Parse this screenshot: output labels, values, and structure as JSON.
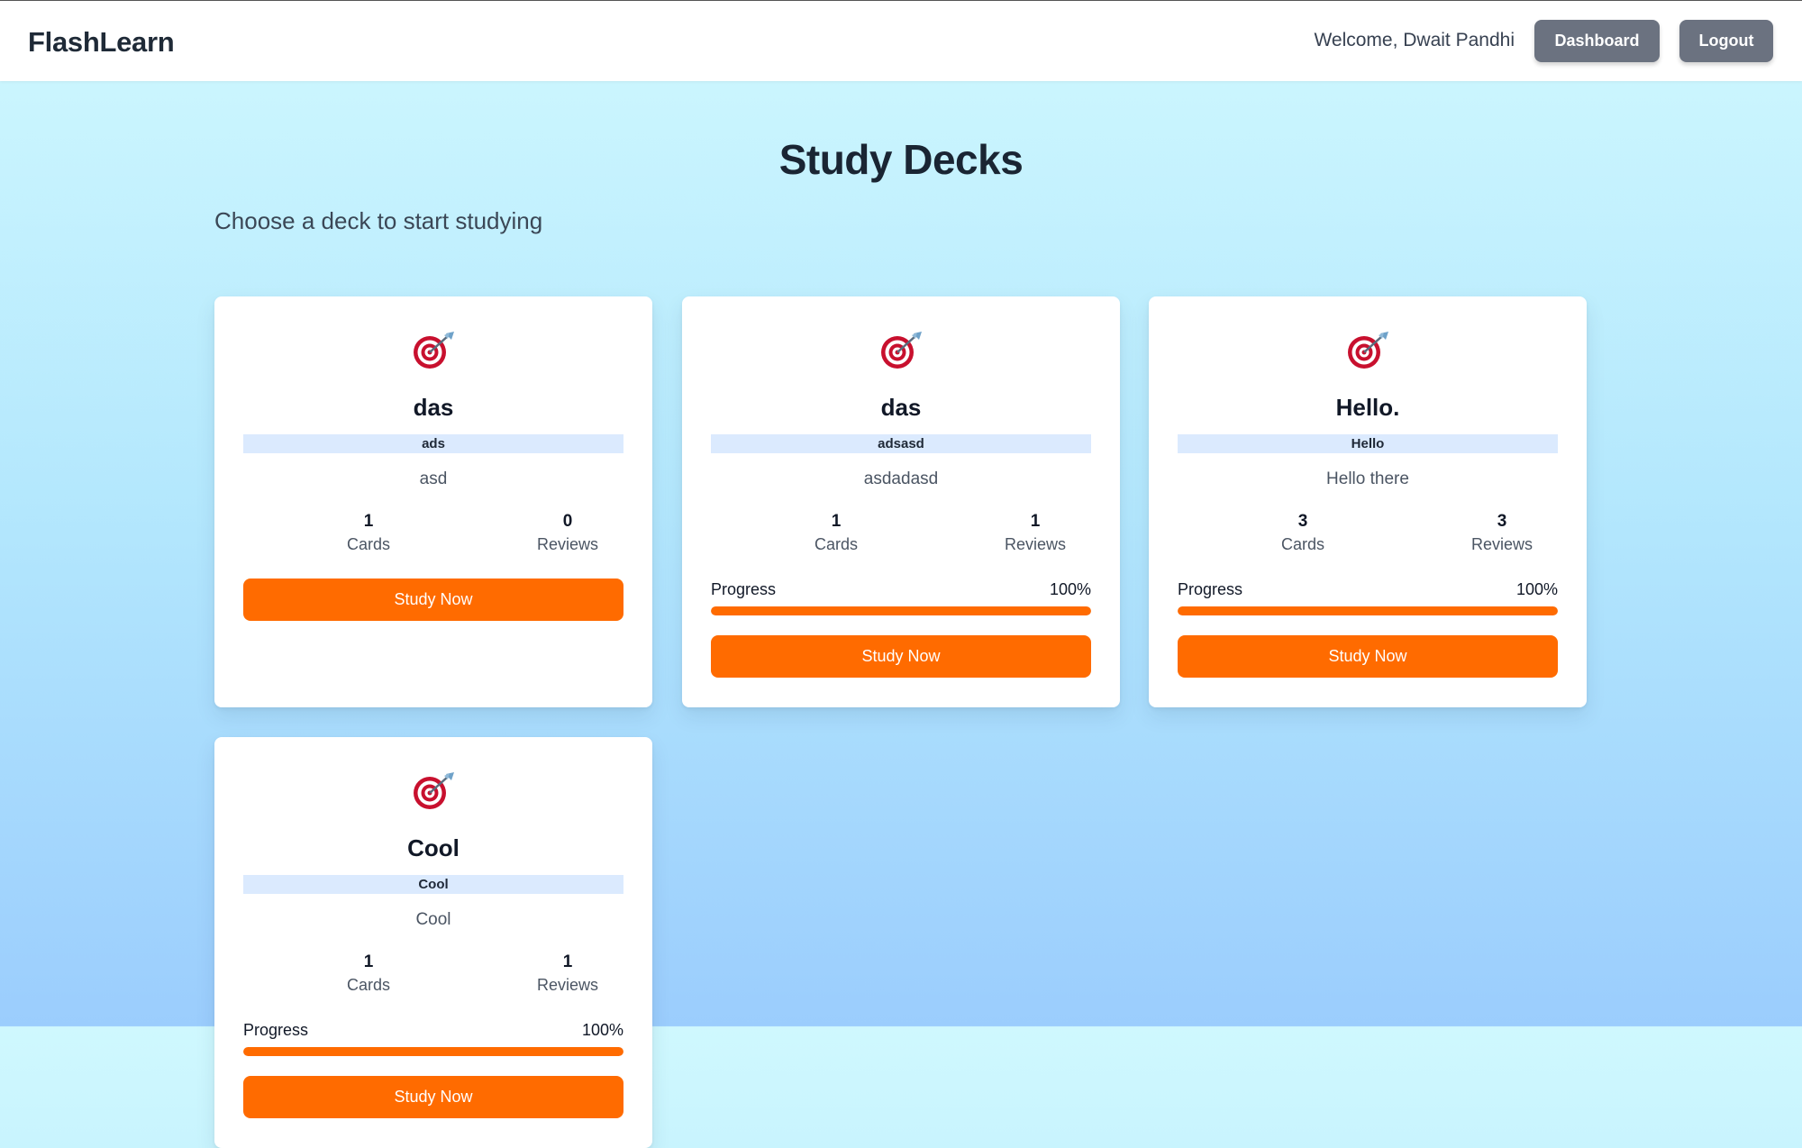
{
  "app": {
    "brand": "FlashLearn",
    "welcome": "Welcome, Dwait Pandhi",
    "dashboard_label": "Dashboard",
    "logout_label": "Logout"
  },
  "page": {
    "title": "Study Decks",
    "subtitle": "Choose a deck to start studying"
  },
  "colors": {
    "accent": "#ff6b00",
    "tag_bg": "#dbeafe",
    "nav_button": "#6b7280"
  },
  "decks": [
    {
      "icon": "target-dart-icon",
      "title": "das",
      "tag": "ads",
      "description": "asd",
      "cards_count": "1",
      "cards_label": "Cards",
      "reviews_count": "0",
      "reviews_label": "Reviews",
      "study_label": "Study Now"
    },
    {
      "icon": "target-dart-icon",
      "title": "das",
      "tag": "adsasd",
      "description": "asdadasd",
      "cards_count": "1",
      "cards_label": "Cards",
      "reviews_count": "1",
      "reviews_label": "Reviews",
      "progress_label": "Progress",
      "progress_pct": "100%",
      "progress_fraction": 1.0,
      "study_label": "Study Now"
    },
    {
      "icon": "target-dart-icon",
      "title": "Hello.",
      "tag": "Hello",
      "description": "Hello there",
      "cards_count": "3",
      "cards_label": "Cards",
      "reviews_count": "3",
      "reviews_label": "Reviews",
      "progress_label": "Progress",
      "progress_pct": "100%",
      "progress_fraction": 1.0,
      "study_label": "Study Now"
    },
    {
      "icon": "target-dart-icon",
      "title": "Cool",
      "tag": "Cool",
      "description": "Cool",
      "cards_count": "1",
      "cards_label": "Cards",
      "reviews_count": "1",
      "reviews_label": "Reviews",
      "progress_label": "Progress",
      "progress_pct": "100%",
      "progress_fraction": 1.0,
      "study_label": "Study Now"
    }
  ]
}
